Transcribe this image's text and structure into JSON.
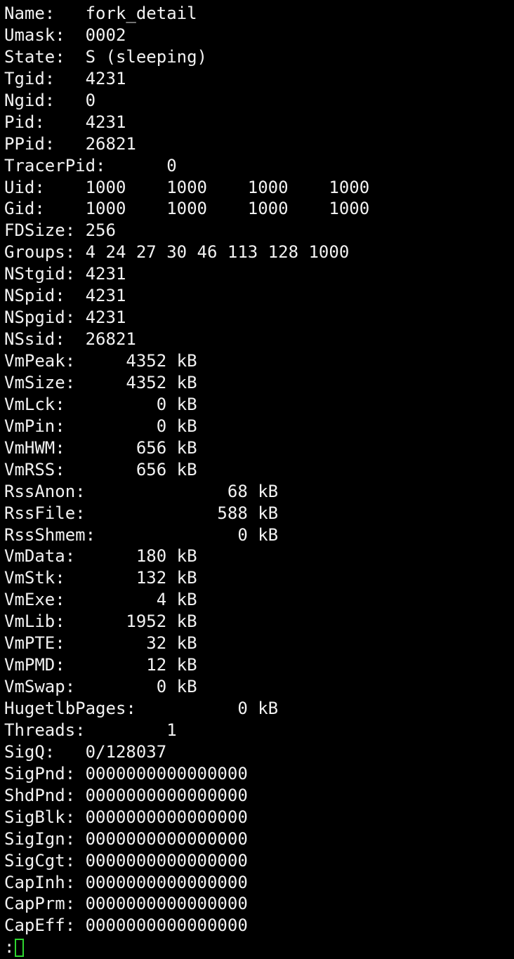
{
  "terminal": {
    "lines": [
      "Name:   fork_detail",
      "Umask:  0002",
      "State:  S (sleeping)",
      "Tgid:   4231",
      "Ngid:   0",
      "Pid:    4231",
      "PPid:   26821",
      "TracerPid:      0",
      "Uid:    1000    1000    1000    1000",
      "Gid:    1000    1000    1000    1000",
      "FDSize: 256",
      "Groups: 4 24 27 30 46 113 128 1000",
      "NStgid: 4231",
      "NSpid:  4231",
      "NSpgid: 4231",
      "NSsid:  26821",
      "VmPeak:     4352 kB",
      "VmSize:     4352 kB",
      "VmLck:         0 kB",
      "VmPin:         0 kB",
      "VmHWM:       656 kB",
      "VmRSS:       656 kB",
      "RssAnon:              68 kB",
      "RssFile:             588 kB",
      "RssShmem:              0 kB",
      "VmData:      180 kB",
      "VmStk:       132 kB",
      "VmExe:         4 kB",
      "VmLib:      1952 kB",
      "VmPTE:        32 kB",
      "VmPMD:        12 kB",
      "VmSwap:        0 kB",
      "HugetlbPages:          0 kB",
      "Threads:        1",
      "SigQ:   0/128037",
      "SigPnd: 0000000000000000",
      "ShdPnd: 0000000000000000",
      "SigBlk: 0000000000000000",
      "SigIgn: 0000000000000000",
      "SigCgt: 0000000000000000",
      "CapInh: 0000000000000000",
      "CapPrm: 0000000000000000",
      "CapEff: 0000000000000000"
    ],
    "prompt": ":",
    "cursor_color": "#2fd62f",
    "text_color": "#f2f2f2",
    "background_color": "#000000"
  }
}
